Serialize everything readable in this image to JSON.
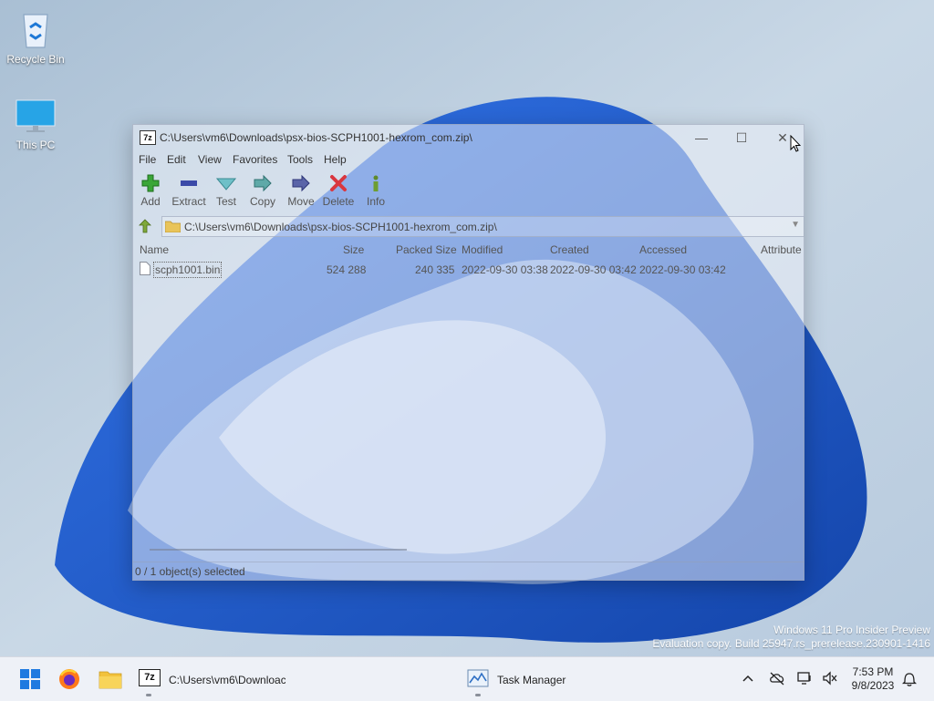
{
  "desktop": {
    "icons": [
      {
        "label": "Recycle Bin"
      },
      {
        "label": "This PC"
      }
    ],
    "watermark": {
      "line1": "Windows 11 Pro Insider Preview",
      "line2": "Evaluation copy. Build 25947.rs_prerelease.230901-1416"
    }
  },
  "window": {
    "title": "C:\\Users\\vm6\\Downloads\\psx-bios-SCPH1001-hexrom_com.zip\\",
    "app_icon_text": "7z",
    "controls": {
      "minimize": "—",
      "maximize": "☐",
      "close": "✕"
    },
    "menu": [
      "File",
      "Edit",
      "View",
      "Favorites",
      "Tools",
      "Help"
    ],
    "toolbar": [
      {
        "label": "Add",
        "icon": "add-icon"
      },
      {
        "label": "Extract",
        "icon": "extract-icon"
      },
      {
        "label": "Test",
        "icon": "test-icon"
      },
      {
        "label": "Copy",
        "icon": "copy-icon"
      },
      {
        "label": "Move",
        "icon": "move-icon"
      },
      {
        "label": "Delete",
        "icon": "delete-icon"
      },
      {
        "label": "Info",
        "icon": "info-icon"
      }
    ],
    "address": {
      "path": "C:\\Users\\vm6\\Downloads\\psx-bios-SCPH1001-hexrom_com.zip\\"
    },
    "columns": [
      "Name",
      "Size",
      "Packed Size",
      "Modified",
      "Created",
      "Accessed",
      "Attribute"
    ],
    "rows": [
      {
        "name": "scph1001.bin",
        "size": "524 288",
        "packed_size": "240 335",
        "modified": "2022-09-30 03:38",
        "created": "2022-09-30 03:42",
        "accessed": "2022-09-30 03:42"
      }
    ],
    "status": "0 / 1 object(s) selected"
  },
  "taskbar": {
    "apps": [
      {
        "label": "C:\\Users\\vm6\\Downloac"
      },
      {
        "label": "Task Manager"
      }
    ],
    "clock": {
      "time": "7:53 PM",
      "date": "9/8/2023"
    }
  },
  "colors": {
    "accent": "#1f5fd8",
    "add_green": "#3aa637",
    "delete_red": "#d9363e",
    "move_blue": "#5a64a8"
  }
}
